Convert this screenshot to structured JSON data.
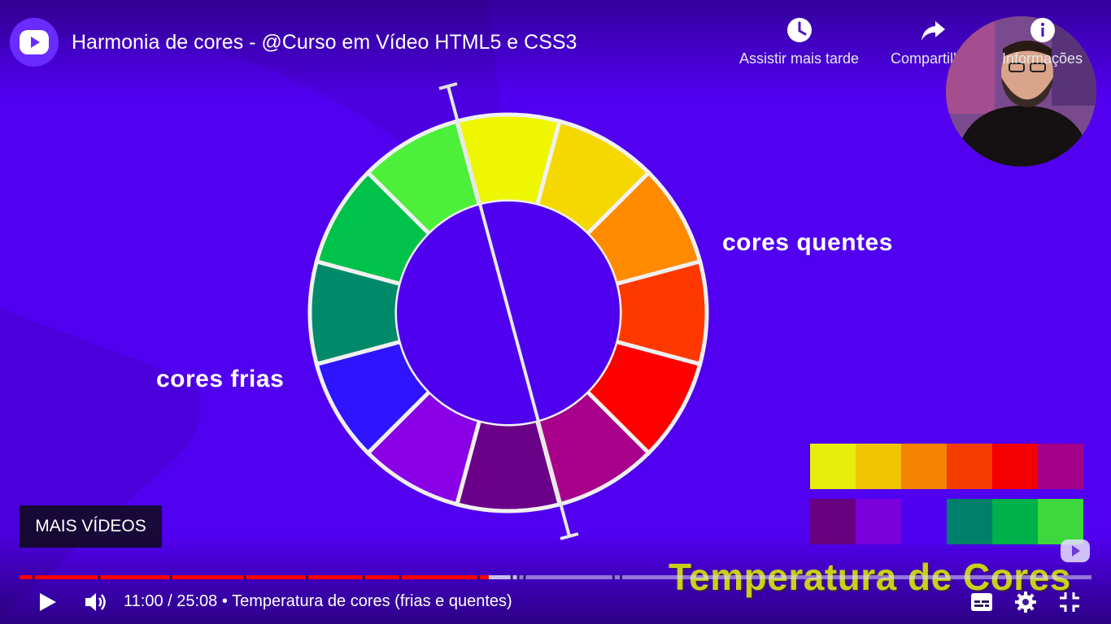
{
  "video": {
    "title": "Harmonia de cores - @Curso em Vídeo HTML5 e CSS3",
    "current_time": "11:00",
    "duration": "25:08",
    "separator": " / ",
    "chapter_sep": " • ",
    "chapter": "Temperatura de cores (frias e quentes)",
    "progress_fraction": 0.4377,
    "buffered_fraction": 0.465
  },
  "top_actions": {
    "watch_later": "Assistir mais tarde",
    "share": "Compartilhar",
    "info": "Informações"
  },
  "slide": {
    "warm_label": "cores quentes",
    "cold_label": "cores frias",
    "heading": "Temperatura de Cores",
    "wheel_colors": [
      "#eef600",
      "#f5d800",
      "#ff8a00",
      "#ff3800",
      "#ff0000",
      "#a8008a",
      "#6a0088",
      "#8a00e6",
      "#2e14ff",
      "#008a6a",
      "#00c24a",
      "#4cf03a"
    ],
    "warm_swatches": [
      "#e6ee0a",
      "#f0c400",
      "#f58200",
      "#f53c00",
      "#f50000",
      "#a5008a"
    ],
    "cold_swatches": [
      "#680080",
      "#7a00dc",
      "#4f00f0",
      "#00806a",
      "#00b048",
      "#3ed83c"
    ]
  },
  "controls": {
    "more_videos": "MAIS VÍDEOS",
    "chapter_marks": [
      0.012,
      0.073,
      0.14,
      0.209,
      0.267,
      0.32,
      0.354,
      0.427,
      0.464,
      0.458,
      0.47,
      0.553,
      0.56
    ]
  },
  "colors": {
    "background": "#5100f0",
    "progress_played": "#ff0000",
    "progress_buffered": "#c8c0f0",
    "accent_text": "#c8d018"
  }
}
